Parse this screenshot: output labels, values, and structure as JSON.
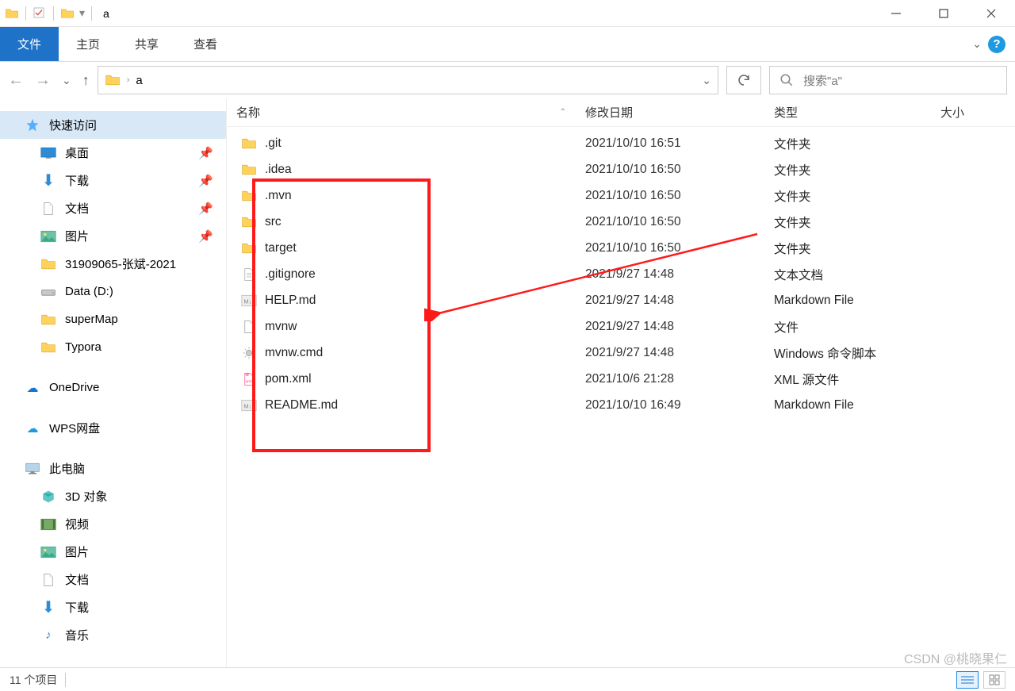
{
  "title": "a",
  "ribbon": {
    "file": "文件",
    "home": "主页",
    "share": "共享",
    "view": "查看"
  },
  "breadcrumb": {
    "path": "a"
  },
  "search": {
    "placeholder": "搜索\"a\""
  },
  "sidebar": {
    "quick": "快速访问",
    "desktop": "桌面",
    "downloads": "下载",
    "documents": "文档",
    "pictures": "图片",
    "custom1": "31909065-张斌-2021",
    "data_d": "Data (D:)",
    "supermap": "superMap",
    "typora": "Typora",
    "onedrive": "OneDrive",
    "wps": "WPS网盘",
    "thispc": "此电脑",
    "obj3d": "3D 对象",
    "videos": "视频",
    "pictures2": "图片",
    "documents2": "文档",
    "downloads2": "下载",
    "music": "音乐"
  },
  "columns": {
    "name": "名称",
    "date": "修改日期",
    "type": "类型",
    "size": "大小"
  },
  "files": [
    {
      "icon": "folder",
      "name": ".git",
      "date": "2021/10/10 16:51",
      "type": "文件夹"
    },
    {
      "icon": "folder",
      "name": ".idea",
      "date": "2021/10/10 16:50",
      "type": "文件夹"
    },
    {
      "icon": "folder",
      "name": ".mvn",
      "date": "2021/10/10 16:50",
      "type": "文件夹"
    },
    {
      "icon": "folder",
      "name": "src",
      "date": "2021/10/10 16:50",
      "type": "文件夹"
    },
    {
      "icon": "folder",
      "name": "target",
      "date": "2021/10/10 16:50",
      "type": "文件夹"
    },
    {
      "icon": "text",
      "name": ".gitignore",
      "date": "2021/9/27 14:48",
      "type": "文本文档"
    },
    {
      "icon": "md",
      "name": "HELP.md",
      "date": "2021/9/27 14:48",
      "type": "Markdown File"
    },
    {
      "icon": "file",
      "name": "mvnw",
      "date": "2021/9/27 14:48",
      "type": "文件"
    },
    {
      "icon": "gear",
      "name": "mvnw.cmd",
      "date": "2021/9/27 14:48",
      "type": "Windows 命令脚本"
    },
    {
      "icon": "xml",
      "name": "pom.xml",
      "date": "2021/10/6 21:28",
      "type": "XML 源文件"
    },
    {
      "icon": "md",
      "name": "README.md",
      "date": "2021/10/10 16:49",
      "type": "Markdown File"
    }
  ],
  "status": {
    "count": "11 个项目"
  },
  "watermark": "CSDN @桃晓果仁"
}
